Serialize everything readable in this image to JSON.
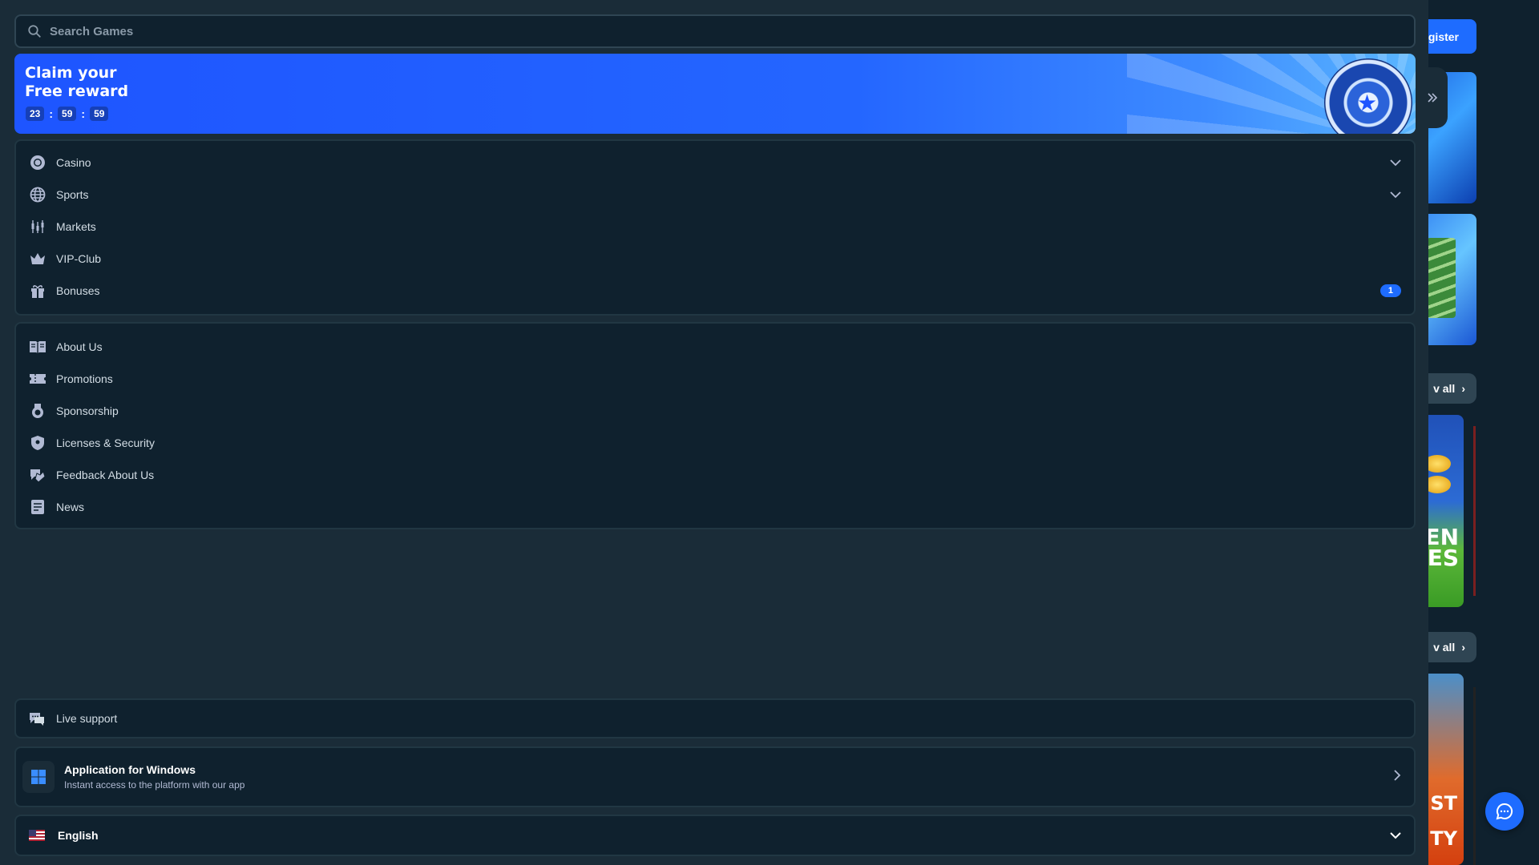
{
  "search": {
    "placeholder": "Search Games"
  },
  "promo": {
    "title_line1": "Claim your",
    "title_line2": "Free reward",
    "timer": [
      "23",
      "59",
      "59"
    ]
  },
  "menu_primary": [
    {
      "label": "Casino",
      "icon": "casino-chip-icon",
      "chevron": true
    },
    {
      "label": "Sports",
      "icon": "globe-icon",
      "chevron": true
    },
    {
      "label": "Markets",
      "icon": "markets-icon"
    },
    {
      "label": "VIP-Club",
      "icon": "crown-icon"
    },
    {
      "label": "Bonuses",
      "icon": "gift-icon",
      "badge": "1"
    }
  ],
  "menu_secondary": [
    {
      "label": "About Us",
      "icon": "book-icon"
    },
    {
      "label": "Promotions",
      "icon": "ticket-icon"
    },
    {
      "label": "Sponsorship",
      "icon": "medal-icon"
    },
    {
      "label": "Licenses & Security",
      "icon": "shield-icon"
    },
    {
      "label": "Feedback About Us",
      "icon": "feedback-icon"
    },
    {
      "label": "News",
      "icon": "newspaper-icon"
    }
  ],
  "support": {
    "label": "Live support"
  },
  "app": {
    "title": "Application for Windows",
    "subtitle": "Instant access to the platform with our app"
  },
  "language": {
    "selected": "English"
  },
  "background": {
    "register_label": "gister",
    "view_all_label": "v all",
    "game1_text": "EN ES",
    "game2_text": "ST NTY"
  },
  "colors": {
    "accent": "#1e6cff",
    "panel": "#0f212e",
    "bg": "#1a2c38"
  }
}
